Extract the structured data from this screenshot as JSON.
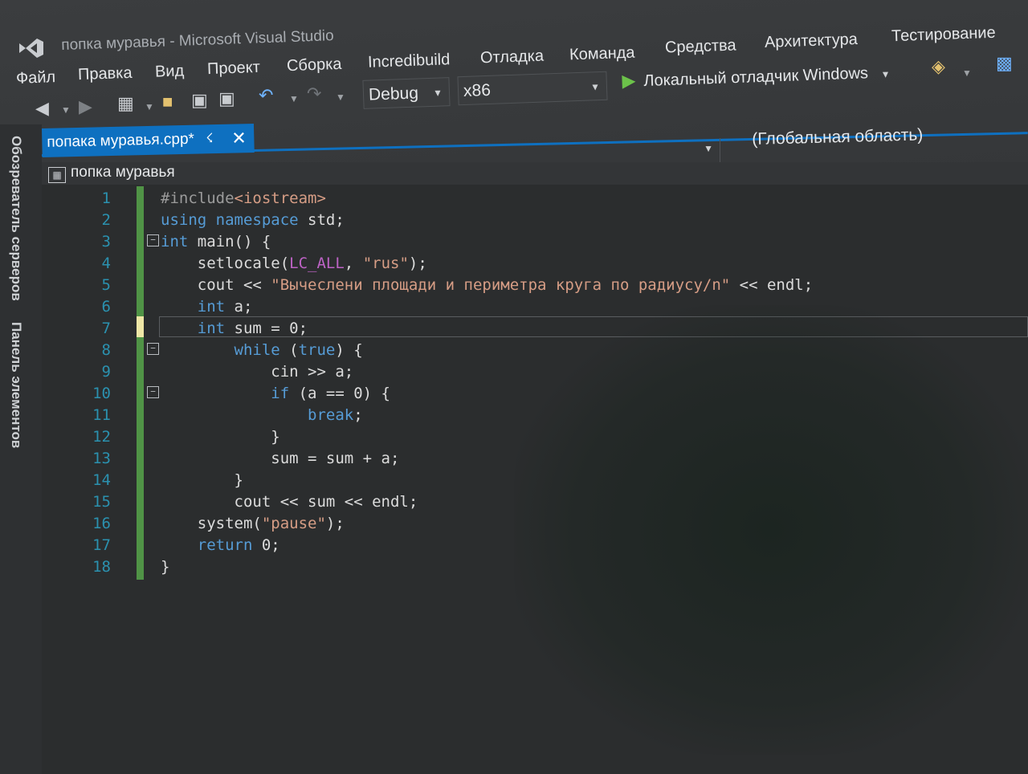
{
  "window": {
    "title": "попка муравья - Microsoft Visual Studio"
  },
  "menu": [
    "Файл",
    "Правка",
    "Вид",
    "Проект",
    "Сборка",
    "Incredibuild",
    "Отладка",
    "Команда",
    "Средства",
    "Архитектура",
    "Тестирование"
  ],
  "toolbar": {
    "configuration": "Debug",
    "platform": "x86",
    "run_label": "Локальный отладчик Windows"
  },
  "side_panels": [
    "Обозреватель серверов",
    "Панель элементов"
  ],
  "document": {
    "tab_label": "попака муравья.cpp*",
    "scope": "(Глобальная область)",
    "project": "попка муравья"
  },
  "code": {
    "line_numbers": [
      "1",
      "2",
      "3",
      "4",
      "5",
      "6",
      "7",
      "8",
      "9",
      "10",
      "11",
      "12",
      "13",
      "14",
      "15",
      "16",
      "17",
      "18"
    ],
    "lines": [
      "#include<iostream>",
      "using namespace std;",
      "int main() {",
      "    setlocale(LC_ALL, \"rus\");",
      "    cout << \"Вычеслени площади и периметра круга по радиусу/n\" << endl;",
      "    int a;",
      "    int sum = 0;",
      "        while (true) {",
      "            cin >> a;",
      "            if (a == 0) {",
      "                break;",
      "            }",
      "            sum = sum + a;",
      "        }",
      "        cout << sum << endl;",
      "    system(\"pause\");",
      "    return 0;",
      "}"
    ]
  }
}
